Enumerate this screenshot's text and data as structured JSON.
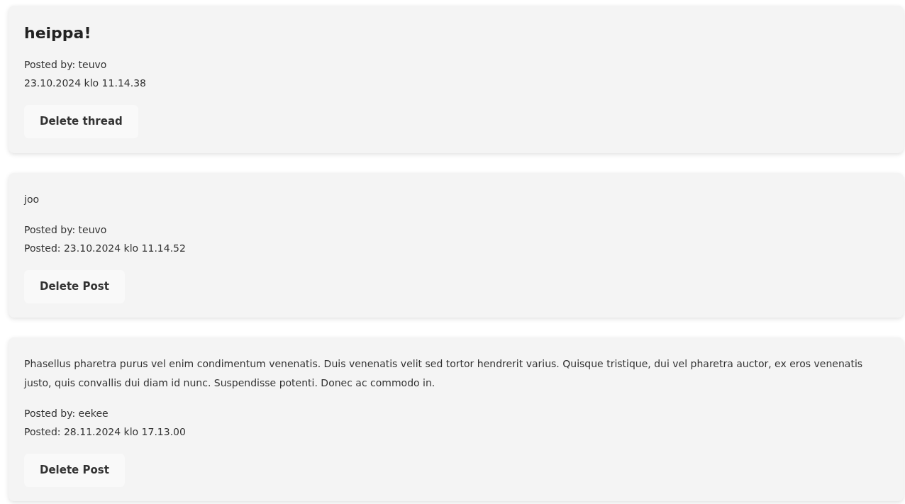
{
  "thread": {
    "title": "heippa!",
    "posted_by": "Posted by: teuvo",
    "date": "23.10.2024 klo 11.14.38",
    "button": "Delete thread"
  },
  "posts": [
    {
      "body": "joo",
      "posted_by": "Posted by: teuvo",
      "posted": "Posted: 23.10.2024 klo 11.14.52",
      "button": "Delete Post"
    },
    {
      "body": "Phasellus pharetra purus vel enim condimentum venenatis. Duis venenatis velit sed tortor hendrerit varius. Quisque tristique, dui vel pharetra auctor, ex eros venenatis justo, quis convallis dui diam id nunc. Suspendisse potenti. Donec ac commodo in.",
      "posted_by": "Posted by: eekee",
      "posted": "Posted: 28.11.2024 klo 17.13.00",
      "button": "Delete Post"
    }
  ]
}
